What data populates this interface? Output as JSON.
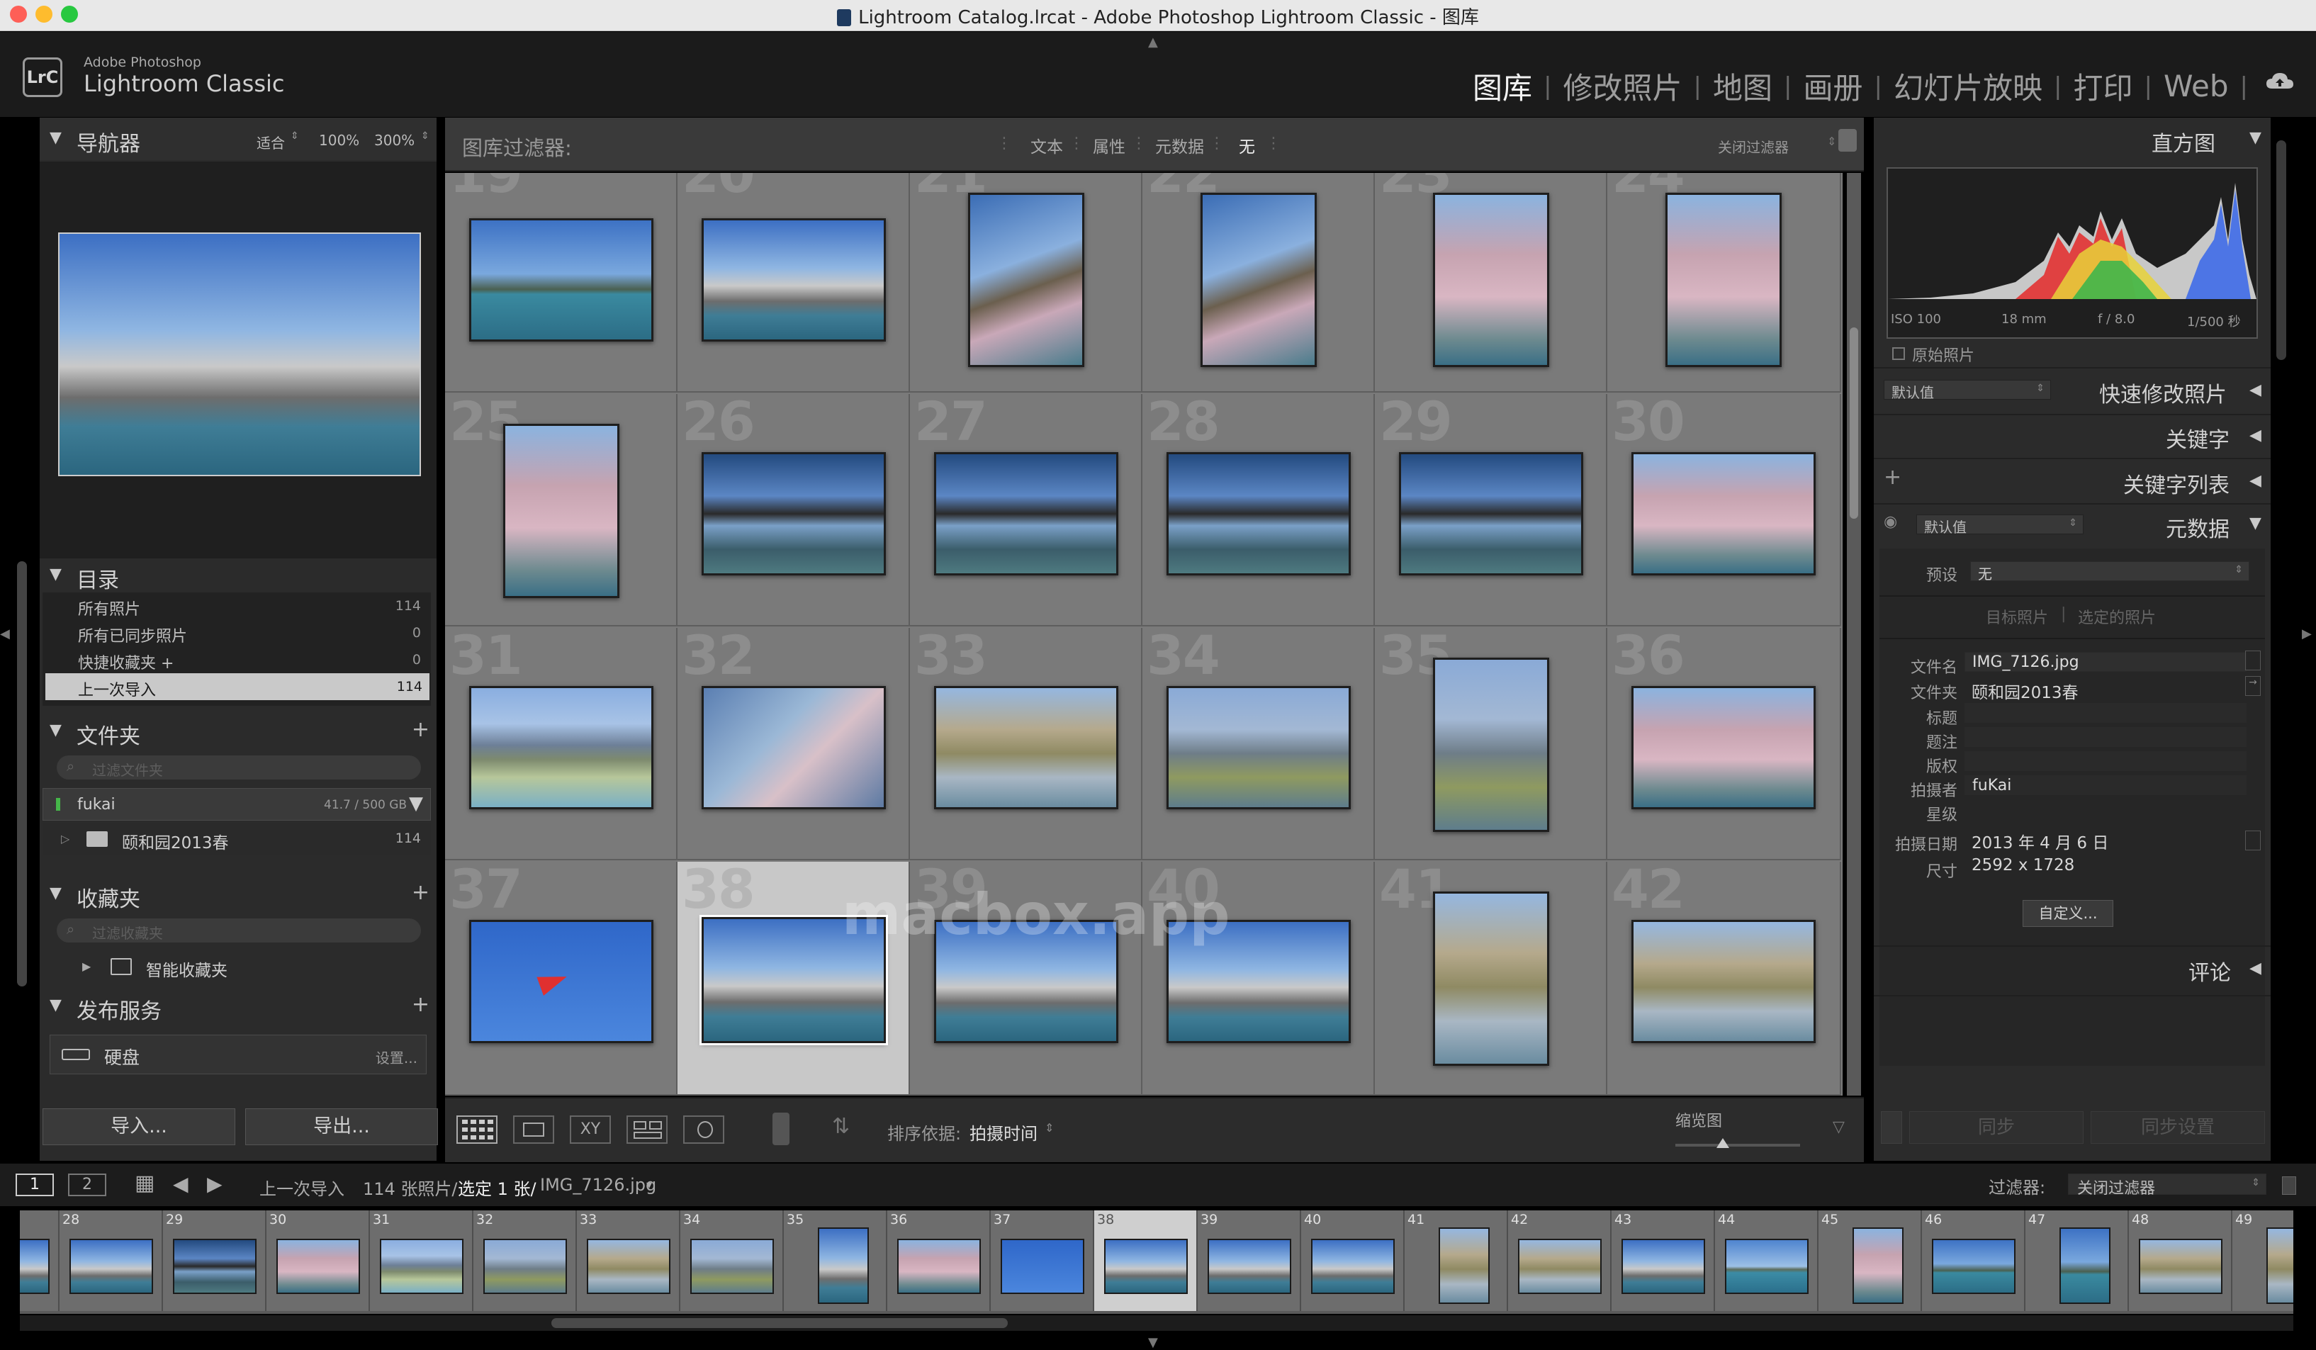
{
  "window": {
    "title": "Lightroom Catalog.lrcat - Adobe Photoshop Lightroom Classic - 图库"
  },
  "brand": {
    "line1": "Adobe Photoshop",
    "line2": "Lightroom Classic",
    "badge": "LrC"
  },
  "modules": [
    "图库",
    "修改照片",
    "地图",
    "画册",
    "幻灯片放映",
    "打印",
    "Web"
  ],
  "active_module": "图库",
  "navigator": {
    "title": "导航器",
    "zoom": [
      "适合",
      "100%",
      "300%"
    ]
  },
  "catalog": {
    "title": "目录",
    "items": [
      {
        "label": "所有照片",
        "count": "114"
      },
      {
        "label": "所有已同步照片",
        "count": "0"
      },
      {
        "label": "快捷收藏夹 +",
        "count": "0"
      },
      {
        "label": "上一次导入",
        "count": "114"
      }
    ]
  },
  "folders": {
    "title": "文件夹",
    "search_placeholder": "过滤文件夹",
    "volume": {
      "name": "fukai",
      "space": "41.7 / 500 GB"
    },
    "folder": {
      "name": "颐和园2013春",
      "count": "114"
    }
  },
  "collections": {
    "title": "收藏夹",
    "search_placeholder": "过滤收藏夹",
    "smart": "智能收藏夹"
  },
  "publish": {
    "title": "发布服务",
    "service": "硬盘",
    "setup": "设置..."
  },
  "left_buttons": {
    "import": "导入...",
    "export": "导出..."
  },
  "filter_bar": {
    "label": "图库过滤器:",
    "tabs": [
      "文本",
      "属性",
      "元数据",
      "无"
    ],
    "right": "关闭过滤器"
  },
  "grid": {
    "rows": [
      [
        "19",
        "20",
        "21",
        "22",
        "23",
        "24"
      ],
      [
        "25",
        "26",
        "27",
        "28",
        "29",
        "30"
      ],
      [
        "31",
        "32",
        "33",
        "34",
        "35",
        "36"
      ],
      [
        "37",
        "38",
        "39",
        "40",
        "41",
        "42"
      ]
    ],
    "selected": "38",
    "watermark": "macbox.app"
  },
  "toolbar": {
    "sort_label": "排序依据:",
    "sort_value": "拍摄时间",
    "thumb_label": "缩览图"
  },
  "histogram": {
    "title": "直方图",
    "iso": "ISO 100",
    "focal": "18 mm",
    "aperture": "f / 8.0",
    "shutter": "1/500 秒",
    "original": "原始照片"
  },
  "quick_develop": {
    "preset": "默认值",
    "title": "快速修改照片"
  },
  "keywording": {
    "title": "关键字"
  },
  "keyword_list": {
    "title": "关键字列表"
  },
  "metadata": {
    "title": "元数据",
    "preset_select": "默认值",
    "preset_label": "预设",
    "preset_value": "无",
    "target_photo": "目标照片",
    "selected_photos": "选定的照片",
    "fields": [
      {
        "label": "文件名",
        "value": "IMG_7126.jpg"
      },
      {
        "label": "文件夹",
        "value": "颐和园2013春"
      },
      {
        "label": "标题",
        "value": ""
      },
      {
        "label": "题注",
        "value": ""
      },
      {
        "label": "版权",
        "value": ""
      },
      {
        "label": "拍摄者",
        "value": "fuKai"
      },
      {
        "label": "星级",
        "value": ""
      },
      {
        "label": "拍摄日期",
        "value": "2013 年 4 月 6 日"
      },
      {
        "label": "尺寸",
        "value": "2592 x 1728"
      }
    ],
    "customize": "自定义..."
  },
  "comments": {
    "title": "评论"
  },
  "right_buttons": {
    "sync": "同步",
    "sync_settings": "同步设置"
  },
  "filmstrip_bar": {
    "monitor1": "1",
    "monitor2": "2",
    "source": "上一次导入",
    "count": "114 张照片/",
    "selected": "选定 1 张/",
    "file": "IMG_7126.jpg",
    "filter_label": "过滤器:",
    "filter_value": "关闭过滤器"
  },
  "filmstrip": {
    "numbers": [
      "",
      "28",
      "29",
      "30",
      "31",
      "32",
      "33",
      "34",
      "35",
      "36",
      "37",
      "38",
      "39",
      "40",
      "41",
      "42",
      "43",
      "44",
      "45",
      "46",
      "47",
      "48",
      "49"
    ],
    "selected": "38"
  },
  "colors": {
    "bg": "#1b1b1b",
    "panel": "#2e2e2e",
    "grid": "#7a7a7a",
    "selected_cell": "#c8c8c8",
    "active_module": "#f2f2f2"
  }
}
